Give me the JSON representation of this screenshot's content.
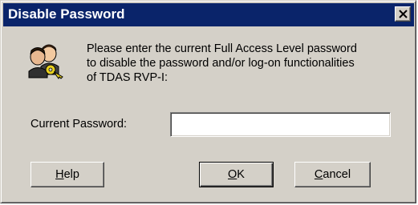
{
  "window": {
    "title": "Disable Password",
    "close_icon": "close-x-icon"
  },
  "message": {
    "line1": "Please enter the current Full Access Level password",
    "line2": "to disable the password and/or log-on functionalities",
    "line3": "of TDAS RVP-I:",
    "icon": "users-key-icon"
  },
  "password": {
    "label": "Current Password:",
    "value": ""
  },
  "buttons": {
    "help": {
      "mnemonic": "H",
      "rest": "elp"
    },
    "ok": {
      "mnemonic": "O",
      "rest": "K"
    },
    "cancel": {
      "mnemonic": "C",
      "rest": "ancel"
    }
  },
  "colors": {
    "titlebar": "#0a246a",
    "face": "#d4d0c8"
  }
}
